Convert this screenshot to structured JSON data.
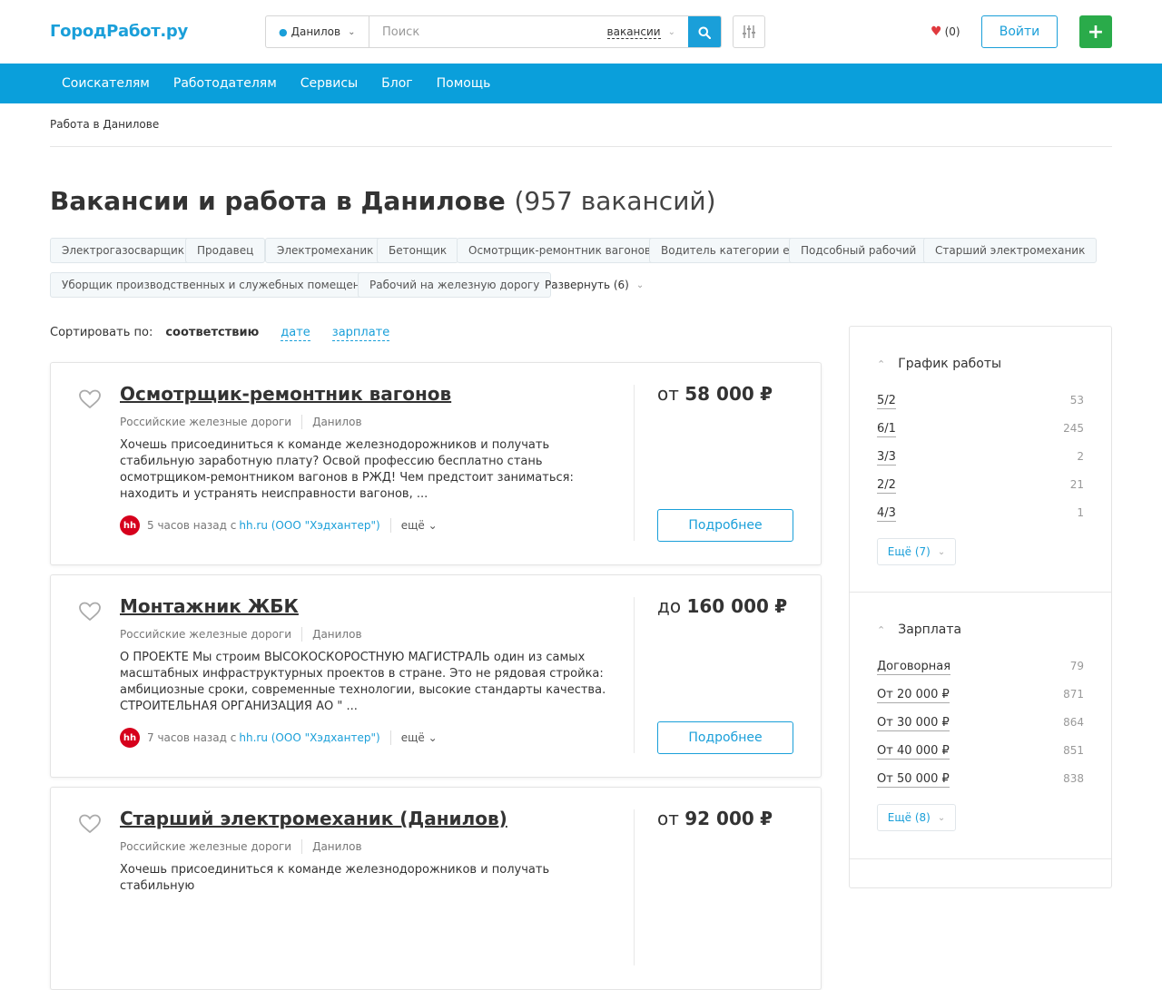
{
  "header": {
    "logo": "ГородРабот.ру",
    "city": "Данилов",
    "search_placeholder": "Поиск",
    "search_type": "вакансии",
    "favorites_count": "(0)",
    "login_label": "Войти",
    "add_label": "+"
  },
  "nav": [
    "Соискателям",
    "Работодателям",
    "Сервисы",
    "Блог",
    "Помощь"
  ],
  "breadcrumb": "Работа в Данилове",
  "page": {
    "title": "Вакансии и работа в Данилове",
    "count": "(957 вакансий)"
  },
  "tags": [
    "Электрогазосварщик",
    "Продавец",
    "Электромеханик",
    "Бетонщик",
    "Осмотрщик-ремонтник вагонов",
    "Водитель категории е",
    "Подсобный рабочий",
    "Старший электромеханик",
    "Уборщик производственных и служебных помещений",
    "Рабочий на железную дорогу"
  ],
  "tags_expand": "Развернуть (6)",
  "sort": {
    "label": "Сортировать по:",
    "active": "соответствию",
    "options": [
      "дате",
      "зарплате"
    ]
  },
  "vacancies": [
    {
      "title": "Осмотрщик-ремонтник вагонов",
      "company": "Российские железные дороги",
      "city": "Данилов",
      "description": "Хочешь присоединиться к команде железнодорожников и получать стабильную заработную плату? Освой профессию бесплатно стань осмотрщиком-ремонтником вагонов в РЖД! Чем предстоит заниматься: находить и устранять неисправности вагонов, ...",
      "time": "5 часов назад с",
      "source": "hh.ru (ООО \"Хэдхантер\")",
      "more": "ещё",
      "salary_prefix": "от",
      "salary_value": "58 000",
      "currency": "₽",
      "details": "Подробнее"
    },
    {
      "title": "Монтажник ЖБК",
      "company": "Российские железные дороги",
      "city": "Данилов",
      "description": "О ПРОЕКТЕ Мы строим ВЫСОКОСКОРОСТНУЮ МАГИСТРАЛЬ один из самых масштабных инфраструктурных проектов в стране. Это не рядовая стройка: амбициозные сроки, современные технологии, высокие стандарты качества. СТРОИТЕЛЬНАЯ ОРГАНИЗАЦИЯ АО \" ...",
      "time": "7 часов назад с",
      "source": "hh.ru (ООО \"Хэдхантер\")",
      "more": "ещё",
      "salary_prefix": "до",
      "salary_value": "160 000",
      "currency": "₽",
      "details": "Подробнее"
    },
    {
      "title": "Старший электромеханик (Данилов)",
      "company": "Российские железные дороги",
      "city": "Данилов",
      "description": "Хочешь присоединиться к команде железнодорожников и получать стабильную",
      "time": "",
      "source": "",
      "more": "",
      "salary_prefix": "от",
      "salary_value": "92 000",
      "currency": "₽",
      "details": "Подробнее"
    }
  ],
  "filters": [
    {
      "title": "График работы",
      "items": [
        {
          "label": "5/2",
          "count": "53"
        },
        {
          "label": "6/1",
          "count": "245"
        },
        {
          "label": "3/3",
          "count": "2"
        },
        {
          "label": "2/2",
          "count": "21"
        },
        {
          "label": "4/3",
          "count": "1"
        }
      ],
      "more": "Ещё (7)"
    },
    {
      "title": "Зарплата",
      "items": [
        {
          "label": "Договорная",
          "count": "79"
        },
        {
          "label": "От 20 000 ₽",
          "count": "871"
        },
        {
          "label": "От 30 000 ₽",
          "count": "864"
        },
        {
          "label": "От 40 000 ₽",
          "count": "851"
        },
        {
          "label": "От 50 000 ₽",
          "count": "838"
        }
      ],
      "more": "Ещё (8)"
    }
  ],
  "colors": {
    "accent": "#1a9fd9",
    "nav": "#0a9fdb",
    "add": "#2aab4a",
    "hh": "#d6001c",
    "heart": "#e0393e"
  }
}
